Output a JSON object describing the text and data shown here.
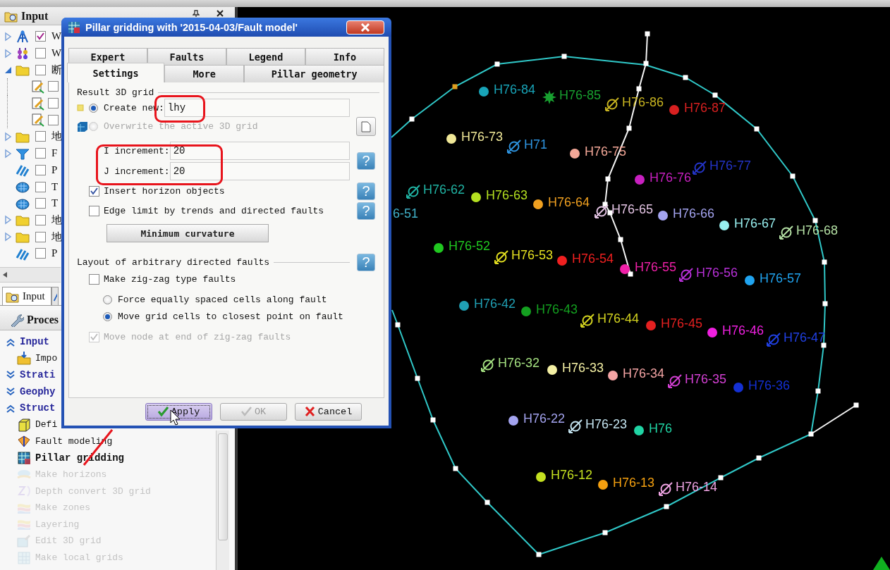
{
  "input_panel": {
    "title": "Input",
    "tree": [
      {
        "kind": "wells",
        "label": "W",
        "checked": true,
        "expanded": false
      },
      {
        "kind": "well-tops",
        "label": "W",
        "checked": false,
        "expanded": false
      },
      {
        "kind": "folder",
        "label": "断",
        "checked": false,
        "expanded": true,
        "children": [
          {
            "kind": "fault-stick",
            "checked": false
          },
          {
            "kind": "fault-stick",
            "checked": false
          },
          {
            "kind": "fault-stick",
            "checked": false
          }
        ]
      },
      {
        "kind": "folder",
        "label": "地",
        "checked": false,
        "expanded": false
      },
      {
        "kind": "funnel",
        "label": "F",
        "checked": false,
        "expanded": false
      },
      {
        "kind": "stripes",
        "label": "P",
        "checked": false
      },
      {
        "kind": "surface-grid",
        "label": "T",
        "checked": false
      },
      {
        "kind": "surface-grid",
        "label": "T",
        "checked": false
      },
      {
        "kind": "folder",
        "label": "地",
        "checked": false,
        "expanded": false
      },
      {
        "kind": "folder",
        "label": "地",
        "checked": false,
        "expanded": false
      },
      {
        "kind": "stripes",
        "label": "P",
        "checked": false
      }
    ]
  },
  "dock_tabs": [
    {
      "label": "Input",
      "selected": true
    },
    {
      "selected": false
    }
  ],
  "processes": {
    "title": "Proces",
    "groups": [
      {
        "label": "Input",
        "expanded": true,
        "items": [
          {
            "kind": "import",
            "label": "Impo",
            "selected": false,
            "disabled": false
          }
        ]
      },
      {
        "label": "Strati",
        "expanded": false
      },
      {
        "label": "Geophy",
        "expanded": false
      },
      {
        "label": "Struct",
        "expanded": true,
        "items": [
          {
            "kind": "cube",
            "label": "Defi",
            "selected": false,
            "disabled": false
          },
          {
            "kind": "fault",
            "label": "Fault modeling",
            "selected": false,
            "disabled": false
          },
          {
            "kind": "pillar",
            "label": "Pillar gridding",
            "selected": true,
            "disabled": false
          },
          {
            "kind": "horizons",
            "label": "Make horizons",
            "selected": false,
            "disabled": true
          },
          {
            "kind": "depth",
            "label": "Depth convert 3D grid",
            "selected": false,
            "disabled": true
          },
          {
            "kind": "zones",
            "label": "Make zones",
            "selected": false,
            "disabled": true
          },
          {
            "kind": "zones",
            "label": "Layering",
            "selected": false,
            "disabled": true
          },
          {
            "kind": "edit",
            "label": "Edit 3D grid",
            "selected": false,
            "disabled": true
          },
          {
            "kind": "local-grids",
            "label": "Make local grids",
            "selected": false,
            "disabled": true
          }
        ]
      }
    ]
  },
  "dialog": {
    "title": "Pillar gridding with '2015-04-03/Fault model'",
    "tab_rows": [
      [
        {
          "label": "Expert",
          "selected": false
        },
        {
          "label": "Faults",
          "selected": false
        },
        {
          "label": "Legend",
          "selected": false
        },
        {
          "label": "Info",
          "selected": false
        }
      ],
      [
        {
          "label": "Settings",
          "selected": true
        },
        {
          "label": "More",
          "selected": false
        },
        {
          "label": "Pillar geometry",
          "selected": false
        }
      ]
    ],
    "result_group": {
      "title": "Result 3D grid",
      "options": [
        {
          "label": "Create new:",
          "selected": true,
          "disabled": false,
          "value": "lhy"
        },
        {
          "label": "Overwrite the active 3D grid",
          "selected": false,
          "disabled": true
        }
      ]
    },
    "increments": {
      "help": "?",
      "fields": [
        {
          "label": "I increment:",
          "value": "20"
        },
        {
          "label": "J increment:",
          "value": "20"
        }
      ]
    },
    "checks": [
      {
        "label": "Insert horizon objects",
        "checked": true,
        "help": "?"
      },
      {
        "label": "Edge limit by trends and directed faults",
        "checked": false,
        "help": "?"
      }
    ],
    "method_button": "Minimum curvature",
    "fault_group": {
      "title": "Layout of arbitrary directed faults",
      "help": "?",
      "zigzag": {
        "label": "Make zig-zag type faults",
        "checked": false,
        "disabled": false
      },
      "options": [
        {
          "label": "Force equally spaced cells along fault",
          "selected": false
        },
        {
          "label": "Move grid cells to closest point on fault",
          "selected": true
        }
      ],
      "move_node": {
        "label": "Move node at end of zig-zag faults",
        "checked": true,
        "disabled": true
      }
    },
    "buttons": [
      {
        "kind": "apply",
        "label": "Apply",
        "disabled": false,
        "focused": true
      },
      {
        "kind": "ok",
        "label": "OK",
        "disabled": true,
        "focused": false
      },
      {
        "kind": "cancel",
        "label": "Cancel",
        "disabled": false,
        "focused": false
      }
    ]
  },
  "map": {
    "wells": [
      {
        "label": "H76-84",
        "kind": "dot",
        "color": "#18a4b8"
      },
      {
        "label": "H76-85",
        "kind": "star",
        "color": "#18a030"
      },
      {
        "label": "H76-86",
        "kind": "injector",
        "color": "#c8b420"
      },
      {
        "label": "H76-87",
        "kind": "dot",
        "color": "#d82020"
      },
      {
        "label": "H76-73",
        "kind": "dot",
        "color": "#f0e898"
      },
      {
        "label": "H71",
        "kind": "injector",
        "color": "#2e94e0"
      },
      {
        "label": "H76-75",
        "kind": "dot",
        "color": "#f4a898"
      },
      {
        "label": "H76-76",
        "kind": "dot",
        "color": "#c820c0"
      },
      {
        "label": "H76-77",
        "kind": "injector",
        "color": "#2434c8"
      },
      {
        "label": "H76-62",
        "kind": "injector",
        "color": "#20b4a4"
      },
      {
        "label": "H76-63",
        "kind": "dot",
        "color": "#b4e020"
      },
      {
        "label": "H76-64",
        "kind": "dot",
        "color": "#f0a020"
      },
      {
        "label": "H76-65",
        "kind": "injector",
        "color": "#e4c4e4"
      },
      {
        "label": "H76-66",
        "kind": "dot",
        "color": "#a4a4f0"
      },
      {
        "label": "H76-67",
        "kind": "dot",
        "color": "#98f0f0"
      },
      {
        "label": "H76-68",
        "kind": "injector",
        "color": "#b4e0a4"
      },
      {
        "label": "6-51",
        "kind": "label-only",
        "color": "#40b0c8"
      },
      {
        "label": "H76-52",
        "kind": "dot",
        "color": "#20c820"
      },
      {
        "label": "H76-53",
        "kind": "injector",
        "color": "#e4e020"
      },
      {
        "label": "H76-54",
        "kind": "dot",
        "color": "#f02020"
      },
      {
        "label": "H76-55",
        "kind": "dot",
        "color": "#f020a8"
      },
      {
        "label": "H76-56",
        "kind": "injector",
        "color": "#b830d8"
      },
      {
        "label": "H76-57",
        "kind": "dot",
        "color": "#20a4f0"
      },
      {
        "label": "H76-42",
        "kind": "dot",
        "color": "#20a0b4"
      },
      {
        "label": "H76-43",
        "kind": "dot",
        "color": "#14a020"
      },
      {
        "label": "H76-44",
        "kind": "injector",
        "color": "#d4d420"
      },
      {
        "label": "H76-45",
        "kind": "dot",
        "color": "#e42020"
      },
      {
        "label": "H76-46",
        "kind": "dot",
        "color": "#f020e0"
      },
      {
        "label": "H76-47",
        "kind": "injector",
        "color": "#2040e4"
      },
      {
        "label": "H76-32",
        "kind": "injector",
        "color": "#a4e080"
      },
      {
        "label": "H76-33",
        "kind": "dot",
        "color": "#f4f0a4"
      },
      {
        "label": "H76-34",
        "kind": "dot",
        "color": "#f4a4a4"
      },
      {
        "label": "H76-35",
        "kind": "injector",
        "color": "#d440d4"
      },
      {
        "label": "H76-36",
        "kind": "dot",
        "color": "#1430d4"
      },
      {
        "label": "H76-22",
        "kind": "dot",
        "color": "#a4a4f0"
      },
      {
        "label": "H76-23",
        "kind": "injector",
        "color": "#c4e4f0"
      },
      {
        "label": "H76",
        "kind": "dot",
        "color": "#20d4a4"
      },
      {
        "label": "H76-12",
        "kind": "dot",
        "color": "#c4e020"
      },
      {
        "label": "H76-13",
        "kind": "dot",
        "color": "#f4a010"
      },
      {
        "label": "H76-14",
        "kind": "injector",
        "color": "#f0a4e4"
      }
    ]
  }
}
